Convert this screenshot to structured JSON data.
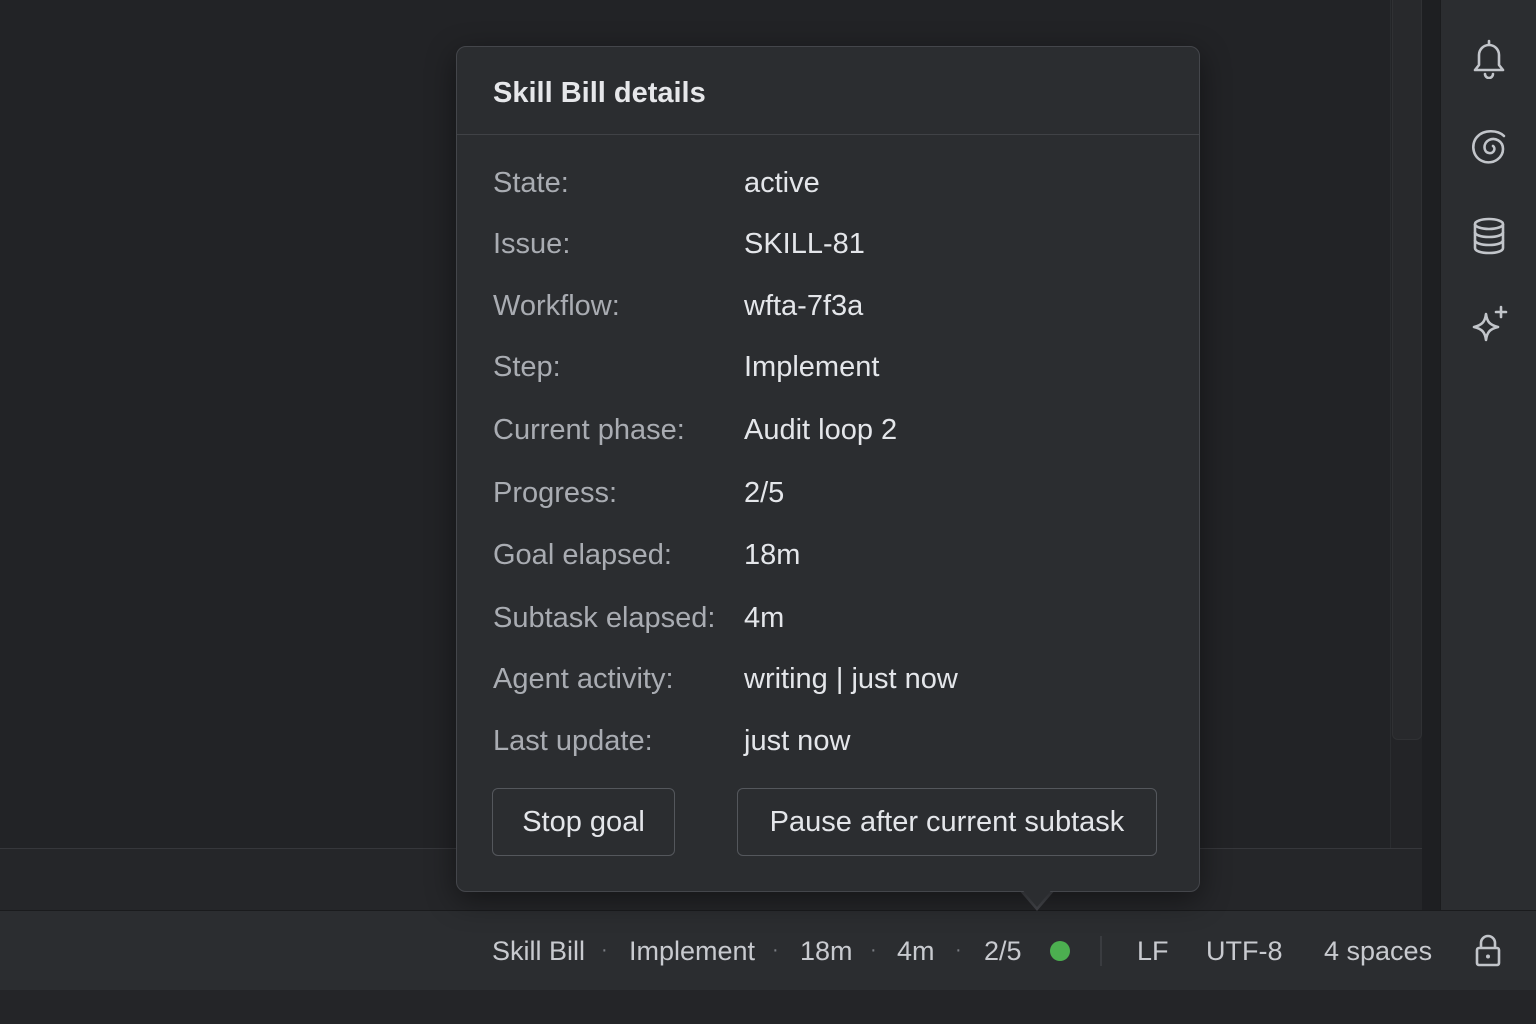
{
  "popup": {
    "title": "Skill Bill details",
    "rows": [
      {
        "label": "State:",
        "value": "active"
      },
      {
        "label": "Issue:",
        "value": "SKILL-81"
      },
      {
        "label": "Workflow:",
        "value": "wfta-7f3a"
      },
      {
        "label": "Step:",
        "value": "Implement"
      },
      {
        "label": "Current phase:",
        "value": "Audit loop 2"
      },
      {
        "label": "Progress:",
        "value": "2/5"
      },
      {
        "label": "Goal elapsed:",
        "value": "18m"
      },
      {
        "label": "Subtask elapsed:",
        "value": "4m"
      },
      {
        "label": "Agent activity:",
        "value": "writing | just now"
      },
      {
        "label": "Last update:",
        "value": "just now"
      }
    ],
    "stop_button": "Stop goal",
    "pause_button": "Pause after current subtask"
  },
  "status_bar": {
    "widget_name": "Skill Bill",
    "step": "Implement",
    "goal_elapsed": "18m",
    "subtask_elapsed": "4m",
    "progress": "2/5",
    "separator": "·",
    "status_color": "#4caf50",
    "line_separator": "LF",
    "encoding": "UTF-8",
    "indent": "4 spaces"
  },
  "right_toolbar": {
    "icons": [
      "bell-icon",
      "spiral-icon",
      "database-icon",
      "sparkle-icon"
    ]
  },
  "colors": {
    "background": "#1e1f22",
    "panel": "#2b2d30",
    "accent_green": "#4caf50"
  }
}
